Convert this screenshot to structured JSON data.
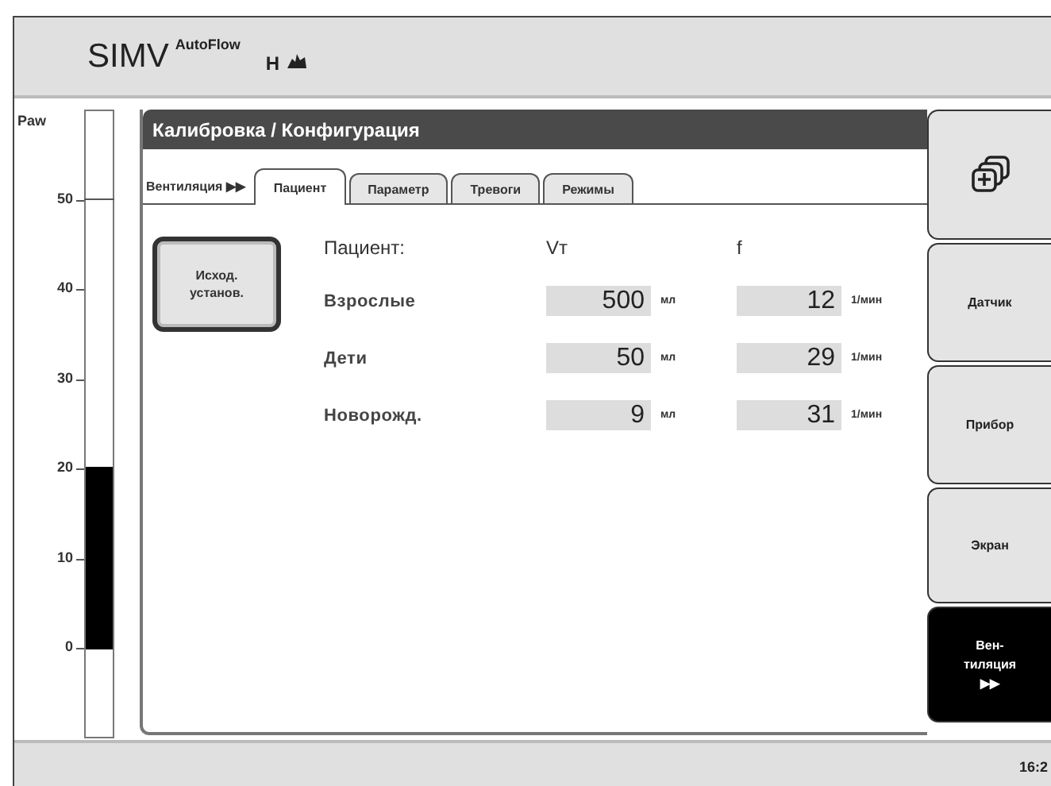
{
  "mode": {
    "name": "SIMV",
    "superscript": "AutoFlow",
    "suffix": "H"
  },
  "gauge": {
    "label": "Paw",
    "scale": [
      "50",
      "40",
      "30",
      "20",
      "10",
      "0"
    ],
    "level": 0.34
  },
  "window": {
    "title": "Калибровка / Конфигурация"
  },
  "breadcrumb": "Вентиляция ▶▶",
  "tabs": [
    {
      "label": "Пациент",
      "selected": true
    },
    {
      "label": "Параметр",
      "selected": false
    },
    {
      "label": "Тревоги",
      "selected": false
    },
    {
      "label": "Режимы",
      "selected": false
    }
  ],
  "reset_button": {
    "lines": [
      "Исход.",
      "установ."
    ]
  },
  "table": {
    "columns": [
      "Пациент:",
      "Vт",
      "f"
    ],
    "rows": [
      {
        "label": "Взрослые",
        "vt": "500",
        "vt_unit": "мл",
        "f": "12",
        "f_unit": "1/мин"
      },
      {
        "label": "Дети",
        "vt": "50",
        "vt_unit": "мл",
        "f": "29",
        "f_unit": "1/мин"
      },
      {
        "label": "Новорожд.",
        "vt": "9",
        "vt_unit": "мл",
        "f": "31",
        "f_unit": "1/мин"
      }
    ]
  },
  "side_buttons": [
    {
      "kind": "icon",
      "selected": false
    },
    {
      "kind": "text",
      "lines": [
        "Датчик"
      ],
      "selected": false
    },
    {
      "kind": "text",
      "lines": [
        "Прибор"
      ],
      "selected": false
    },
    {
      "kind": "text",
      "lines": [
        "Экран"
      ],
      "selected": false
    },
    {
      "kind": "text",
      "lines": [
        "Вен-",
        "тиляция",
        "▶▶"
      ],
      "selected": true
    }
  ],
  "status_bar": {
    "time": "16:2"
  }
}
